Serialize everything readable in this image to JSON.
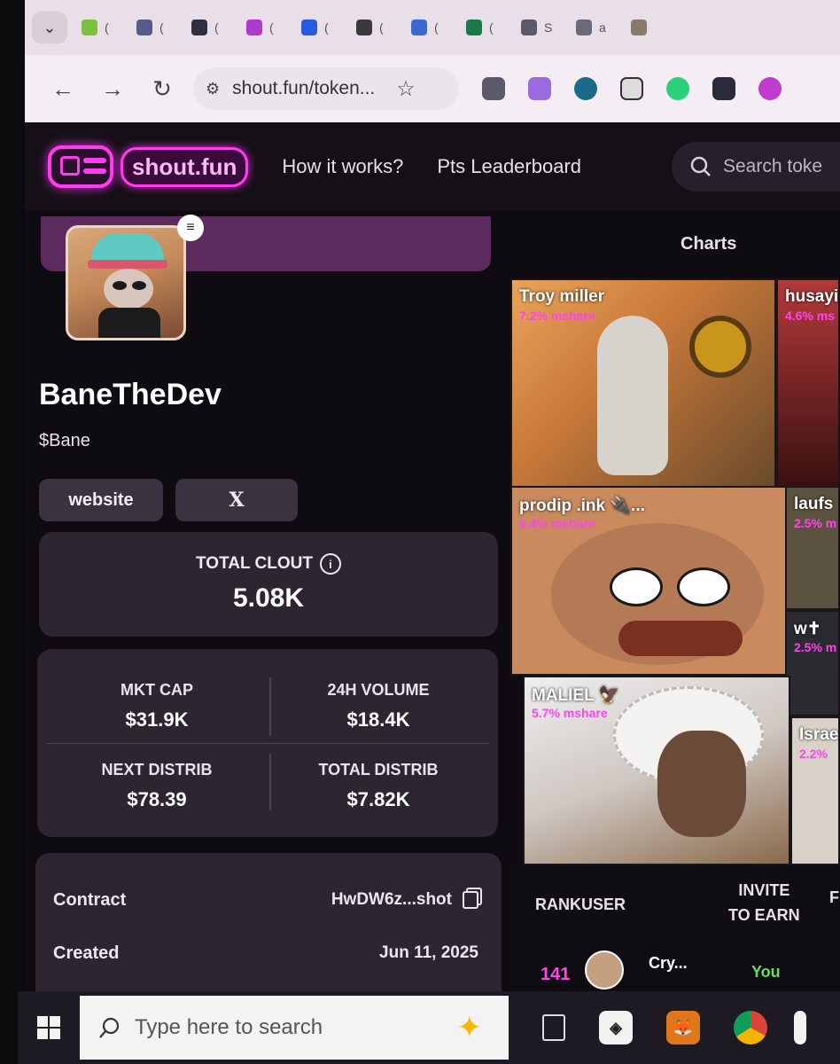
{
  "browser": {
    "tabs": [
      {
        "label": "(",
        "color": "#7fbf3f"
      },
      {
        "label": "(",
        "color": "#5a5a8a"
      },
      {
        "label": "(",
        "color": "#2f2f3f"
      },
      {
        "label": "(",
        "color": "#b03ad0"
      },
      {
        "label": "(",
        "color": "#2a5adf"
      },
      {
        "label": "(",
        "color": "#3a3a3a"
      },
      {
        "label": "(",
        "color": "#3a6ad0"
      },
      {
        "label": "(",
        "color": "#1a7a4a"
      },
      {
        "label": "S",
        "color": "#5a5a6a"
      },
      {
        "label": "a",
        "color": "#6a6a7a"
      },
      {
        "label": "",
        "color": "#8a7a6a"
      }
    ],
    "url": "shout.fun/token..."
  },
  "site": {
    "logo_text": "shout.fun",
    "nav": [
      "How it works?",
      "Pts Leaderboard"
    ],
    "search_placeholder": "Search toke"
  },
  "token": {
    "name": "BaneTheDev",
    "ticker": "$Bane",
    "links": [
      "website",
      "X"
    ],
    "clout_label": "TOTAL CLOUT",
    "clout_value": "5.08K",
    "stats": {
      "mkt_cap_label": "MKT CAP",
      "mkt_cap": "$31.9K",
      "volume_label": "24H VOLUME",
      "volume": "$18.4K",
      "next_label": "NEXT DISTRIB",
      "next": "$78.39",
      "total_label": "TOTAL DISTRIB",
      "total": "$7.82K"
    },
    "contract_label": "Contract",
    "contract": "HwDW6z...shot",
    "created_label": "Created",
    "created": "Jun 11, 2025"
  },
  "charts": {
    "label": "Charts",
    "tiles": {
      "troy": {
        "name": "Troy miller",
        "share": "7.2% mshare"
      },
      "husay": {
        "name": "husayi",
        "share": "4.6% ms"
      },
      "prodip": {
        "name": "prodip .ink 🔌...",
        "share": "6.4% mshare"
      },
      "laufs": {
        "name": "laufs",
        "share": "2.5% m"
      },
      "wt": {
        "name": "w✝︎",
        "share": "2.5% m"
      },
      "maliel": {
        "name": "MALIEL 🦅",
        "share": "5.7% mshare"
      },
      "israe": {
        "name": "Israe",
        "share": "2.2%"
      }
    }
  },
  "leaderboard": {
    "rank_header": "RANKUSER",
    "invite_header_1": "INVITE",
    "invite_header_2": "TO EARN",
    "extra_header": "F",
    "row": {
      "rank": "141",
      "user": "Cry...",
      "you": "You"
    }
  },
  "taskbar": {
    "search_placeholder": "Type here to search"
  }
}
